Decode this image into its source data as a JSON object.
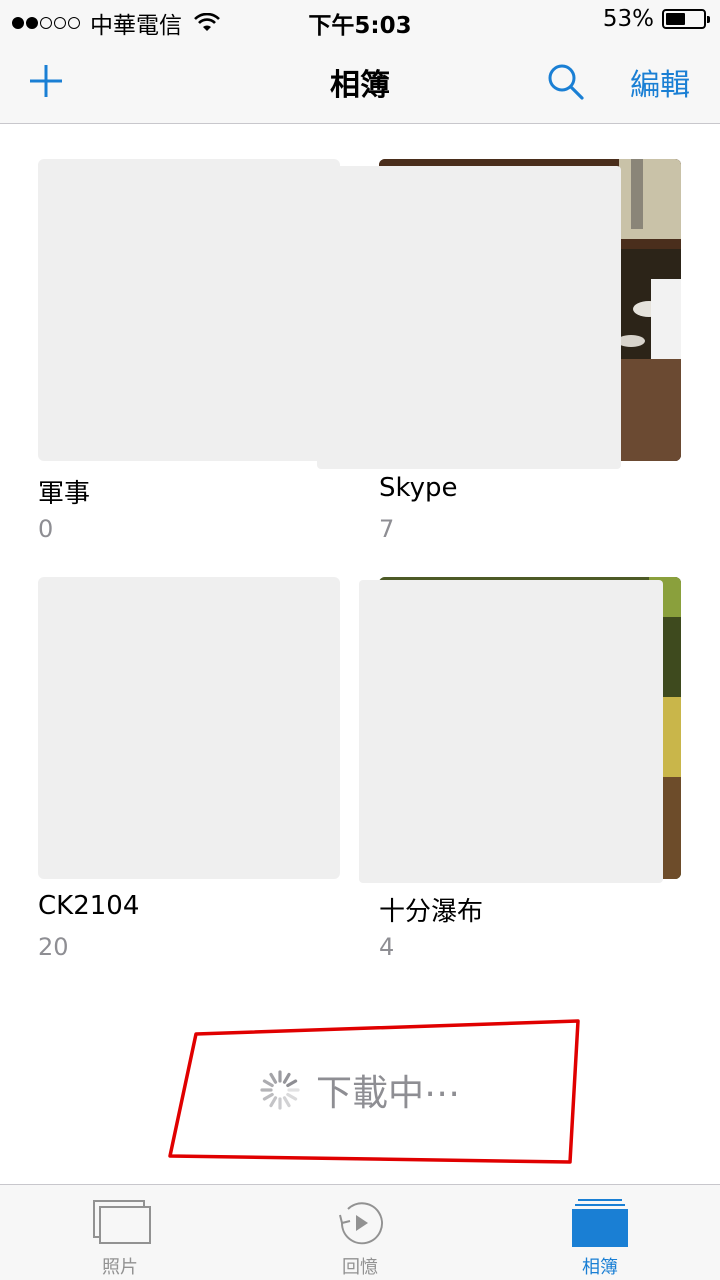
{
  "status_bar": {
    "carrier": "中華電信",
    "time": "下午5:03",
    "battery": "53%",
    "battery_level": 0.53,
    "signal_bars_filled": 2,
    "signal_bars_total": 5
  },
  "nav": {
    "title": "相簿",
    "edit_label": "編輯",
    "add_icon": "plus-icon",
    "search_icon": "search-icon"
  },
  "albums": [
    {
      "title": "軍事",
      "count": "0"
    },
    {
      "title": "Skype",
      "count": "7"
    },
    {
      "title": "CK2104",
      "count": "20"
    },
    {
      "title": "十分瀑布",
      "count": "4"
    }
  ],
  "download": {
    "text": "下載中⋯",
    "icon": "spinner-icon"
  },
  "tabs": [
    {
      "label": "照片",
      "icon": "photos-icon"
    },
    {
      "label": "回憶",
      "icon": "memories-icon"
    },
    {
      "label": "相簿",
      "icon": "albums-icon",
      "active": true
    }
  ],
  "colors": {
    "accent": "#1a7fd4",
    "annotation": "#e00000",
    "placeholder": "#efefef"
  }
}
